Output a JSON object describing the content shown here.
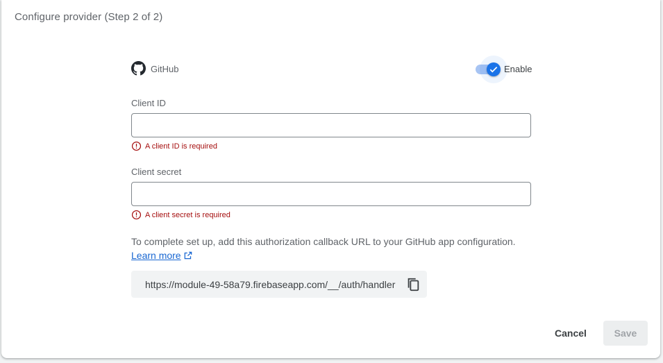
{
  "header": {
    "title": "Configure provider (Step 2 of 2)"
  },
  "provider": {
    "name": "GitHub",
    "icon": "github-icon",
    "enable_label": "Enable",
    "enabled": true
  },
  "client_id": {
    "label": "Client ID",
    "value": "",
    "error": "A client ID is required"
  },
  "client_secret": {
    "label": "Client secret",
    "value": "",
    "error": "A client secret is required"
  },
  "callback": {
    "instructions": "To complete set up, add this authorization callback URL to your GitHub app configuration.",
    "learn_more": "Learn more",
    "url": "https://module-49-58a79.firebaseapp.com/__/auth/handler"
  },
  "actions": {
    "cancel_label": "Cancel",
    "save_label": "Save"
  },
  "colors": {
    "accent": "#1a73e8",
    "error": "#a50e0e",
    "link": "#1967d2"
  }
}
